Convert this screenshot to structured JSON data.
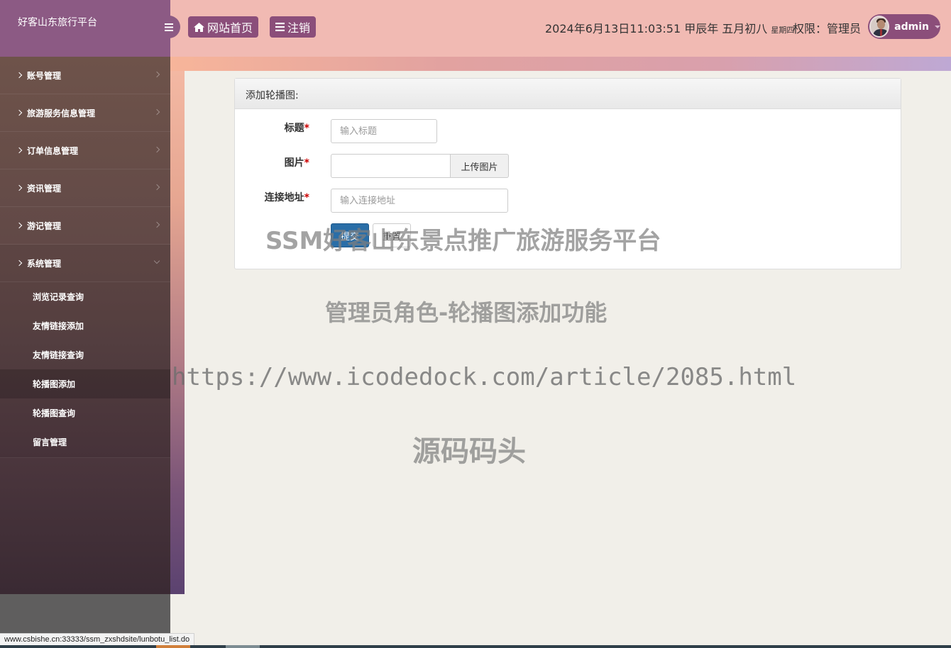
{
  "header": {
    "brand": "好客山东旅行平台",
    "home_label": "网站首页",
    "logout_label": "注销",
    "datetime": "2024年6月13日11:03:51 甲辰年 五月初八",
    "weekday": "星期四",
    "permission": "权限：管理员",
    "username": "admin"
  },
  "sidebar": {
    "groups": [
      {
        "label": "账号管理"
      },
      {
        "label": "旅游服务信息管理"
      },
      {
        "label": "订单信息管理"
      },
      {
        "label": "资讯管理"
      },
      {
        "label": "游记管理"
      },
      {
        "label": "系统管理"
      }
    ],
    "sub_items": [
      {
        "label": "浏览记录查询"
      },
      {
        "label": "友情链接添加"
      },
      {
        "label": "友情链接查询"
      },
      {
        "label": "轮播图添加"
      },
      {
        "label": "轮播图查询"
      },
      {
        "label": "留言管理"
      }
    ]
  },
  "form": {
    "heading": "添加轮播图:",
    "title_label": "标题",
    "title_placeholder": "输入标题",
    "image_label": "图片",
    "upload_label": "上传图片",
    "link_label": "连接地址",
    "link_placeholder": "输入连接地址",
    "required_mark": "*",
    "submit_label": "提交",
    "reset_label": "重置"
  },
  "watermarks": {
    "line1": "SSM好客山东景点推广旅游服务平台",
    "line2": "管理员角色-轮播图添加功能",
    "line3": "https://www.icodedock.com/article/2085.html",
    "line4": "源码码头"
  },
  "status_bar": {
    "url": "www.csbishe.cn:33333/ssm_zxshdsite/lunbotu_list.do"
  },
  "colors": {
    "header_bg": "#f1bab3",
    "brand_bg": "#8c5a84",
    "button_bg": "#8b4e7a",
    "submit_bg": "#2a6ea7",
    "required": "#cc0000"
  }
}
